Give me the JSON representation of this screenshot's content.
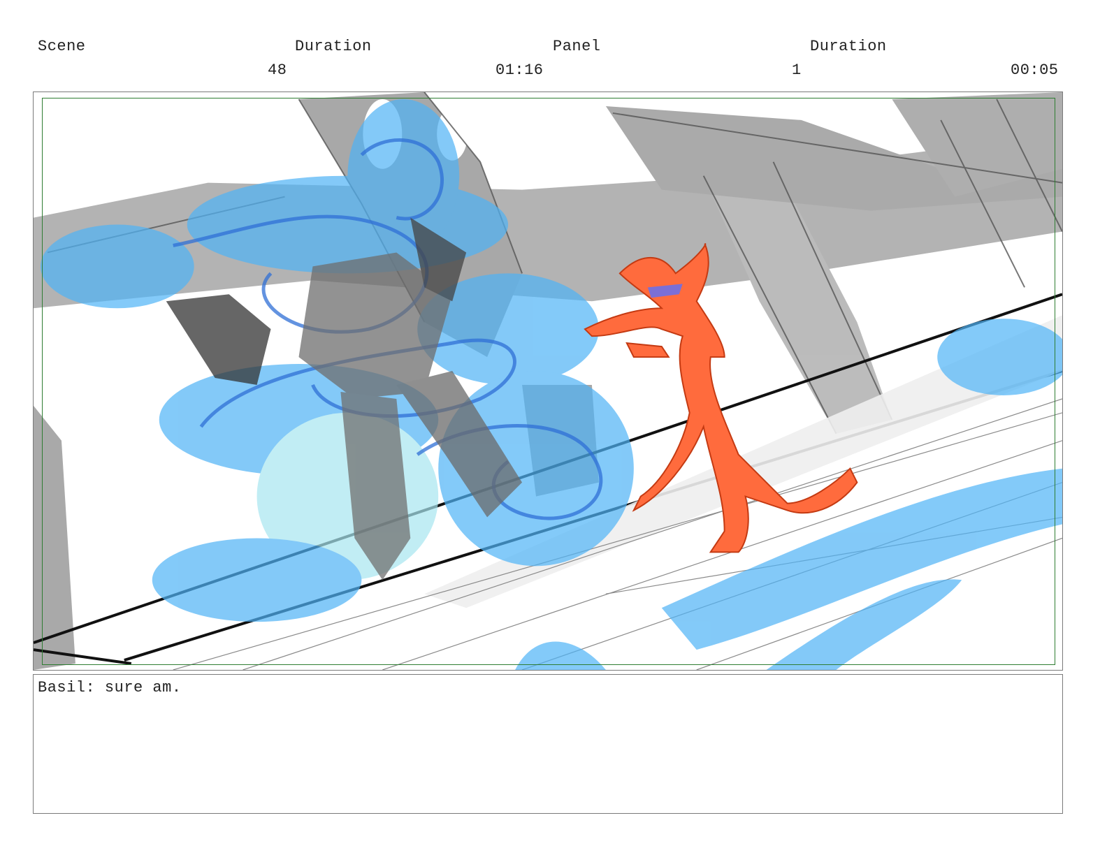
{
  "header": {
    "scene_label": "Scene",
    "scene_duration_label": "Duration",
    "panel_label": "Panel",
    "panel_duration_label": "Duration",
    "scene_value": "48",
    "scene_duration_value": "01:16",
    "panel_value": "1",
    "panel_duration_value": "00:05"
  },
  "panel": {
    "colors": {
      "background_gray": "#9e9e9e",
      "water_blue": "#4fb3f6",
      "water_dark_blue": "#2f6fd6",
      "character_orange": "#ff6b3d",
      "safe_area_green": "#2e7d32"
    }
  },
  "dialogue": {
    "text": "Basil: sure am."
  }
}
